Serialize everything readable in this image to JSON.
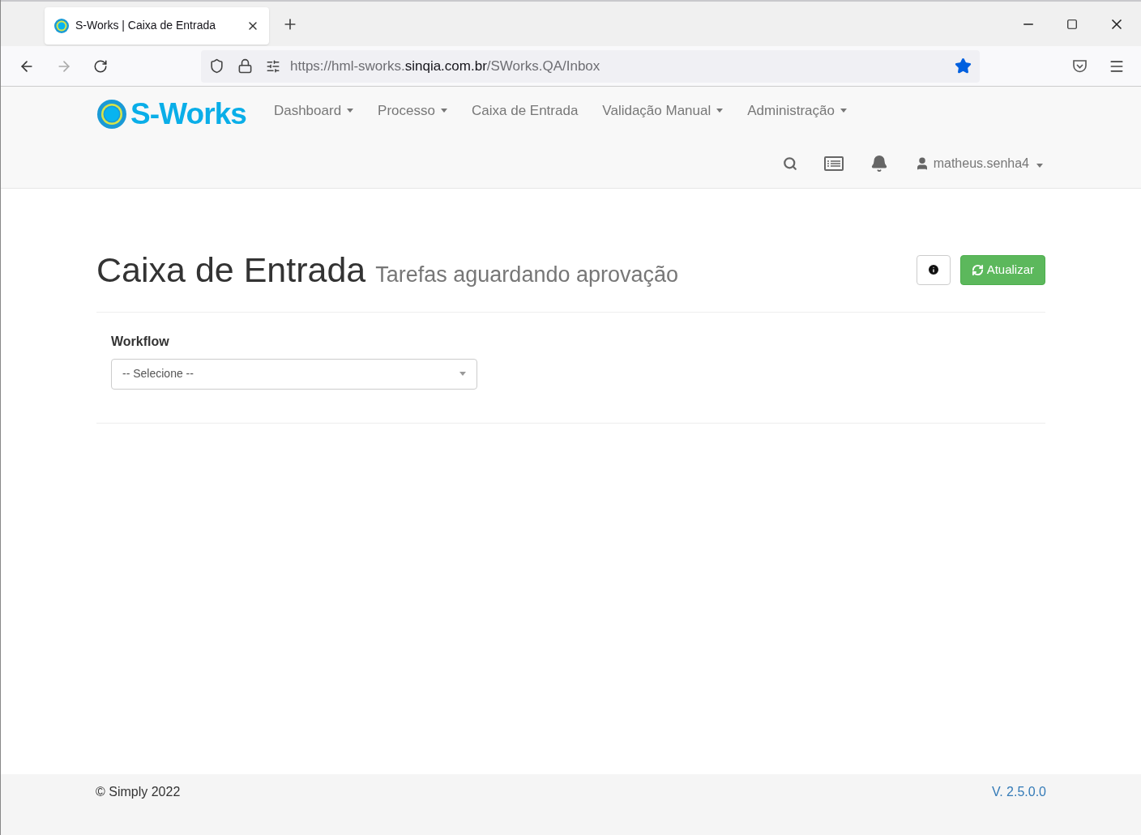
{
  "browser": {
    "tab_title": "S-Works | Caixa de Entrada",
    "url": {
      "prefix": "https://hml-sworks.",
      "domain": "sinqia.com.br",
      "path": "/SWorks.QA/Inbox"
    },
    "bookmarked": true
  },
  "navbar": {
    "logo": "S-Works",
    "items": [
      {
        "label": "Dashboard",
        "has_menu": true
      },
      {
        "label": "Processo",
        "has_menu": true
      },
      {
        "label": "Caixa de Entrada",
        "has_menu": false
      },
      {
        "label": "Validação Manual",
        "has_menu": true
      },
      {
        "label": "Administração",
        "has_menu": true
      }
    ],
    "user": "matheus.senha4"
  },
  "page": {
    "title": "Caixa de Entrada",
    "subtitle": "Tarefas aguardando aprovação",
    "refresh_button": "Atualizar"
  },
  "filter": {
    "label": "Workflow",
    "select_value": "-- Selecione --"
  },
  "footer": {
    "copyright": "© Simply 2022",
    "version": "V. 2.5.0.0"
  }
}
